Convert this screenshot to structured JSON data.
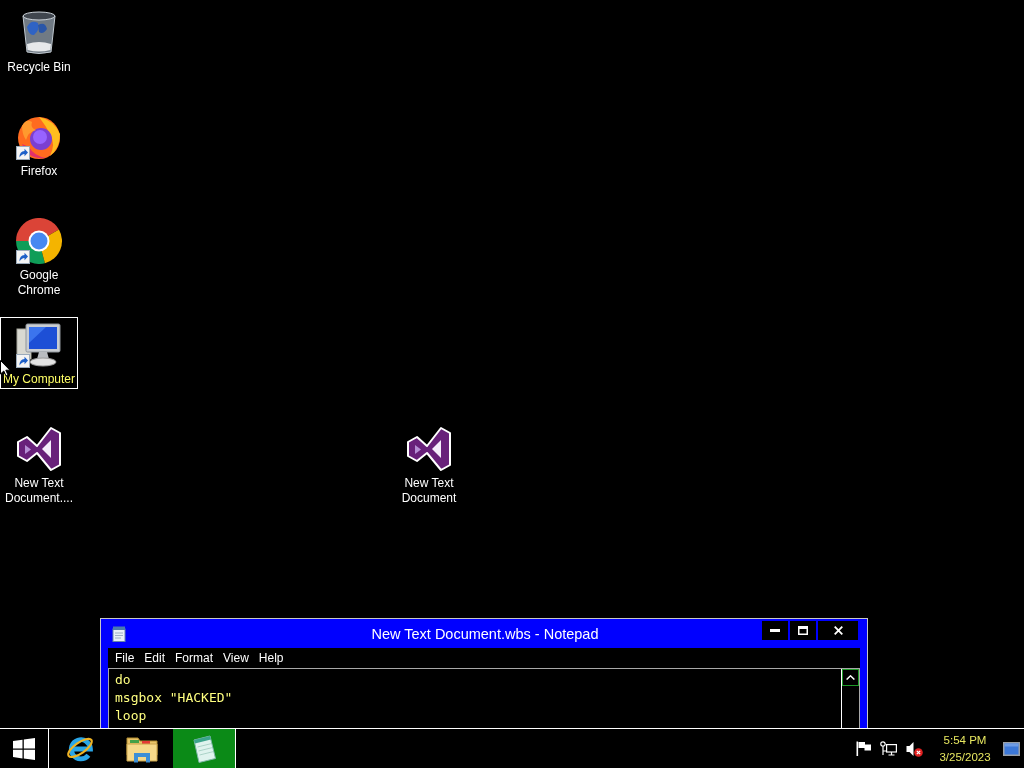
{
  "desktop": {
    "icons": [
      {
        "label": "Recycle Bin",
        "kind": "recycle-bin",
        "shortcut": false,
        "selected": false
      },
      {
        "label": "Firefox",
        "kind": "firefox",
        "shortcut": true,
        "selected": false
      },
      {
        "label": "Google Chrome",
        "kind": "chrome",
        "shortcut": true,
        "selected": false
      },
      {
        "label": "My Computer",
        "kind": "computer",
        "shortcut": true,
        "selected": true
      },
      {
        "label": "New Text Document....",
        "kind": "script",
        "shortcut": false,
        "selected": false
      },
      {
        "label": "New Text Document",
        "kind": "script",
        "shortcut": false,
        "selected": false
      }
    ]
  },
  "notepad": {
    "title": "New Text Document.wbs - Notepad",
    "menu": [
      "File",
      "Edit",
      "Format",
      "View",
      "Help"
    ],
    "lines": [
      "do",
      "msgbox \"HACKED\"",
      "loop"
    ]
  },
  "taskbar": {
    "apps": [
      {
        "kind": "internet-explorer",
        "selected": false
      },
      {
        "kind": "file-explorer",
        "selected": false
      },
      {
        "kind": "notepad",
        "selected": true
      }
    ],
    "tray": [
      {
        "kind": "flag"
      },
      {
        "kind": "network"
      }
    ],
    "volume": {
      "muted": true
    },
    "clock": {
      "time": "5:54 PM",
      "date": "3/25/2023"
    }
  }
}
